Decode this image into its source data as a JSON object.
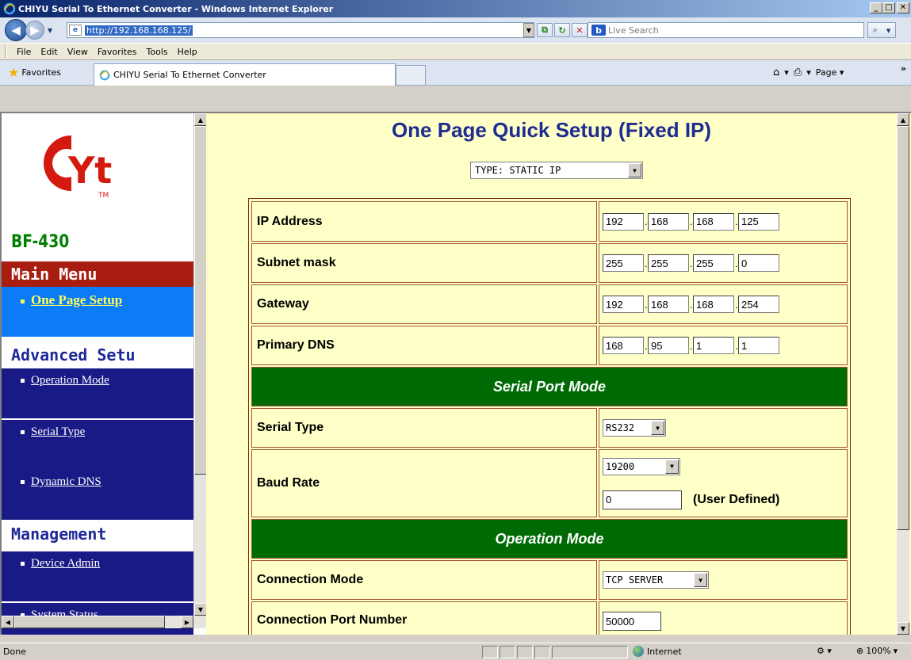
{
  "window": {
    "title": "CHIYU Serial To Ethernet Converter - Windows Internet Explorer",
    "btn_min": "_",
    "btn_max": "□",
    "btn_close": "✕"
  },
  "address": {
    "url": "http://192.168.168.125/",
    "search_placeholder": "Live Search"
  },
  "menu": {
    "items": [
      "File",
      "Edit",
      "View",
      "Favorites",
      "Tools",
      "Help"
    ]
  },
  "favbar": {
    "favorites_label": "Favorites",
    "tab_title": "CHIYU Serial To Ethernet Converter",
    "page_label": "Page ▾"
  },
  "sidebar": {
    "logo_text": "Yt",
    "logo_tm": "TM",
    "model": "BF-430",
    "main_menu": "Main Menu",
    "one_page_setup": "One Page Setup",
    "advanced_setup": "Advanced Setu",
    "operation_mode": "Operation Mode",
    "serial_type": "Serial Type",
    "dynamic_dns": "Dynamic DNS",
    "management": "Management",
    "device_admin": "Device Admin",
    "system_status": "System Status"
  },
  "main": {
    "title": "One Page Quick Setup (Fixed IP)",
    "ip_type": "TYPE: STATIC IP",
    "ip_address_label": "IP Address",
    "ip_address": [
      "192",
      "168",
      "168",
      "125"
    ],
    "subnet_label": "Subnet mask",
    "subnet": [
      "255",
      "255",
      "255",
      "0"
    ],
    "gateway_label": "Gateway",
    "gateway": [
      "192",
      "168",
      "168",
      "254"
    ],
    "dns_label": "Primary DNS",
    "dns": [
      "168",
      "95",
      "1",
      "1"
    ],
    "serial_section": "Serial Port Mode",
    "serial_type_label": "Serial Type",
    "serial_type": "RS232",
    "baud_label": "Baud Rate",
    "baud": "19200",
    "user_baud": "0",
    "user_defined": "(User Defined)",
    "op_section": "Operation Mode",
    "conn_mode_label": "Connection Mode",
    "conn_mode": "TCP SERVER",
    "port_label": "Connection Port Number",
    "port": "50000"
  },
  "status": {
    "text": "Done",
    "zone": "Internet",
    "zoom": "100%"
  },
  "colors": {
    "menu_red": "#a81d10",
    "active_blue": "#0c7bf6",
    "nav_dark": "#1a1a86",
    "section_green": "#006b05",
    "content_bg": "#ffffc8"
  }
}
